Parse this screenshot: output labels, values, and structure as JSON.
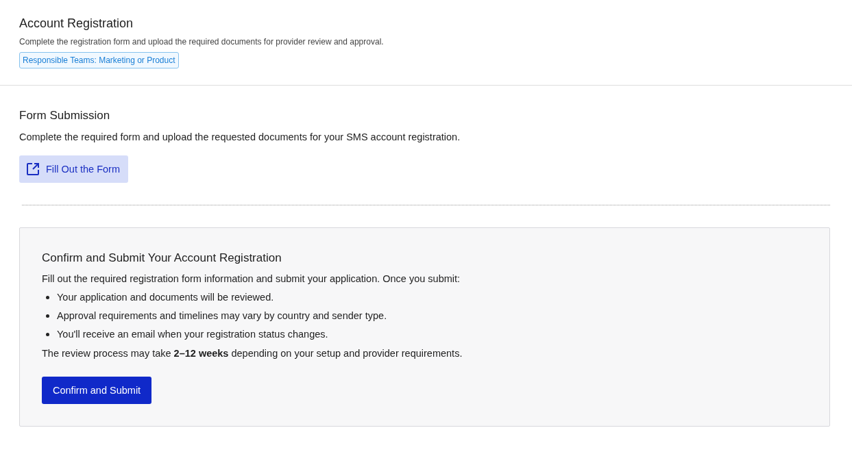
{
  "header": {
    "title": "Account Registration",
    "subtitle": "Complete the registration form and upload the required documents for provider review and approval.",
    "badge": "Responsible Teams: Marketing or Product"
  },
  "form_section": {
    "title": "Form Submission",
    "description": "Complete the required form and upload the requested documents for your SMS account registration.",
    "button": "Fill Out the Form"
  },
  "confirm_card": {
    "title": "Confirm and Submit Your Account Registration",
    "intro": "Fill out the required registration form information and submit your application. Once you submit:",
    "bullets": [
      "Your application and documents will be reviewed.",
      "Approval requirements and timelines may vary by country and sender type.",
      "You'll receive an email when your registration status changes."
    ],
    "note": "The review process may take **2–12 weeks** depending on your setup and provider requirements.",
    "button": "Confirm and Submit"
  }
}
